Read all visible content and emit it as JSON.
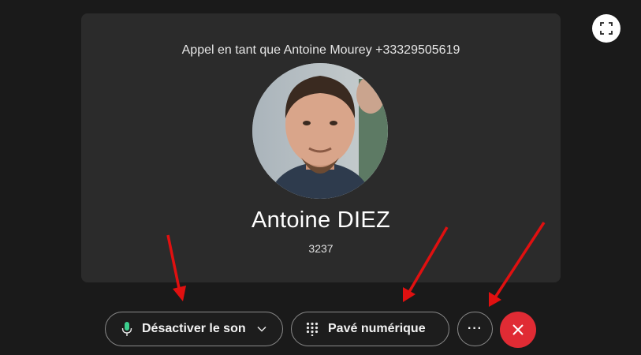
{
  "call": {
    "calling_as": "Appel en tant que Antoine Mourey +33329505619",
    "contact_name": "Antoine DIEZ",
    "contact_number": "3237"
  },
  "controls": {
    "mute_label": "Désactiver le son",
    "keypad_label": "Pavé numérique",
    "more_label": "···"
  },
  "icons": {
    "fullscreen": "fullscreen-icon",
    "microphone": "microphone-icon",
    "chevron": "chevron-down-icon",
    "keypad": "dialpad-icon",
    "hangup": "close-icon"
  },
  "colors": {
    "background": "#1a1a1a",
    "card": "#2b2b2b",
    "hangup": "#e02b34",
    "mic_active": "#3ccf8e",
    "annotation_arrow": "#e01010"
  }
}
